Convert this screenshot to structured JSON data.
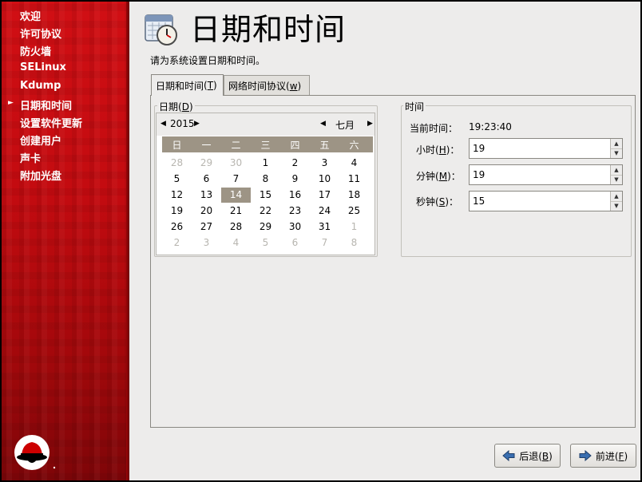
{
  "sidebar": {
    "steps": [
      {
        "label": "欢迎"
      },
      {
        "label": "许可协议"
      },
      {
        "label": "防火墙"
      },
      {
        "label": "SELinux"
      },
      {
        "label": "Kdump"
      },
      {
        "label": "日期和时间",
        "current": true
      },
      {
        "label": "设置软件更新"
      },
      {
        "label": "创建用户"
      },
      {
        "label": "声卡"
      },
      {
        "label": "附加光盘"
      }
    ]
  },
  "header": {
    "title": "日期和时间",
    "subtitle": "请为系统设置日期和时间。",
    "icon": "calendar-clock-icon"
  },
  "tabs": [
    {
      "label": "日期和时间",
      "mnemonic": "T",
      "active": true
    },
    {
      "label": "网络时间协议",
      "mnemonic": "w",
      "active": false
    }
  ],
  "date_group": {
    "label": "日期",
    "mnemonic": "D",
    "year": "2015",
    "month": "七月",
    "weekdays": [
      "日",
      "一",
      "二",
      "三",
      "四",
      "五",
      "六"
    ],
    "weeks": [
      [
        {
          "d": "28",
          "o": true
        },
        {
          "d": "29",
          "o": true
        },
        {
          "d": "30",
          "o": true
        },
        {
          "d": "1"
        },
        {
          "d": "2"
        },
        {
          "d": "3"
        },
        {
          "d": "4"
        }
      ],
      [
        {
          "d": "5"
        },
        {
          "d": "6"
        },
        {
          "d": "7"
        },
        {
          "d": "8"
        },
        {
          "d": "9"
        },
        {
          "d": "10"
        },
        {
          "d": "11"
        }
      ],
      [
        {
          "d": "12"
        },
        {
          "d": "13"
        },
        {
          "d": "14",
          "s": true
        },
        {
          "d": "15"
        },
        {
          "d": "16"
        },
        {
          "d": "17"
        },
        {
          "d": "18"
        }
      ],
      [
        {
          "d": "19"
        },
        {
          "d": "20"
        },
        {
          "d": "21"
        },
        {
          "d": "22"
        },
        {
          "d": "23"
        },
        {
          "d": "24"
        },
        {
          "d": "25"
        }
      ],
      [
        {
          "d": "26"
        },
        {
          "d": "27"
        },
        {
          "d": "28"
        },
        {
          "d": "29"
        },
        {
          "d": "30"
        },
        {
          "d": "31"
        },
        {
          "d": "1",
          "o": true
        }
      ],
      [
        {
          "d": "2",
          "o": true
        },
        {
          "d": "3",
          "o": true
        },
        {
          "d": "4",
          "o": true
        },
        {
          "d": "5",
          "o": true
        },
        {
          "d": "6",
          "o": true
        },
        {
          "d": "7",
          "o": true
        },
        {
          "d": "8",
          "o": true
        }
      ]
    ]
  },
  "time_group": {
    "label": "时间",
    "current_label": "当前时间：",
    "current_value": "19:23:40",
    "fields": {
      "hour": {
        "label": "小时",
        "mnemonic": "H",
        "value": "19"
      },
      "minute": {
        "label": "分钟",
        "mnemonic": "M",
        "value": "19"
      },
      "second": {
        "label": "秒钟",
        "mnemonic": "S",
        "value": "15"
      }
    }
  },
  "buttons": {
    "back": {
      "label": "后退",
      "mnemonic": "B"
    },
    "next": {
      "label": "前进",
      "mnemonic": "F"
    }
  },
  "colors": {
    "sidebar_red": "#c30b10",
    "calendar_header": "#9d9485",
    "selected_day": "#9d9485",
    "panel_bg": "#edeceb"
  }
}
